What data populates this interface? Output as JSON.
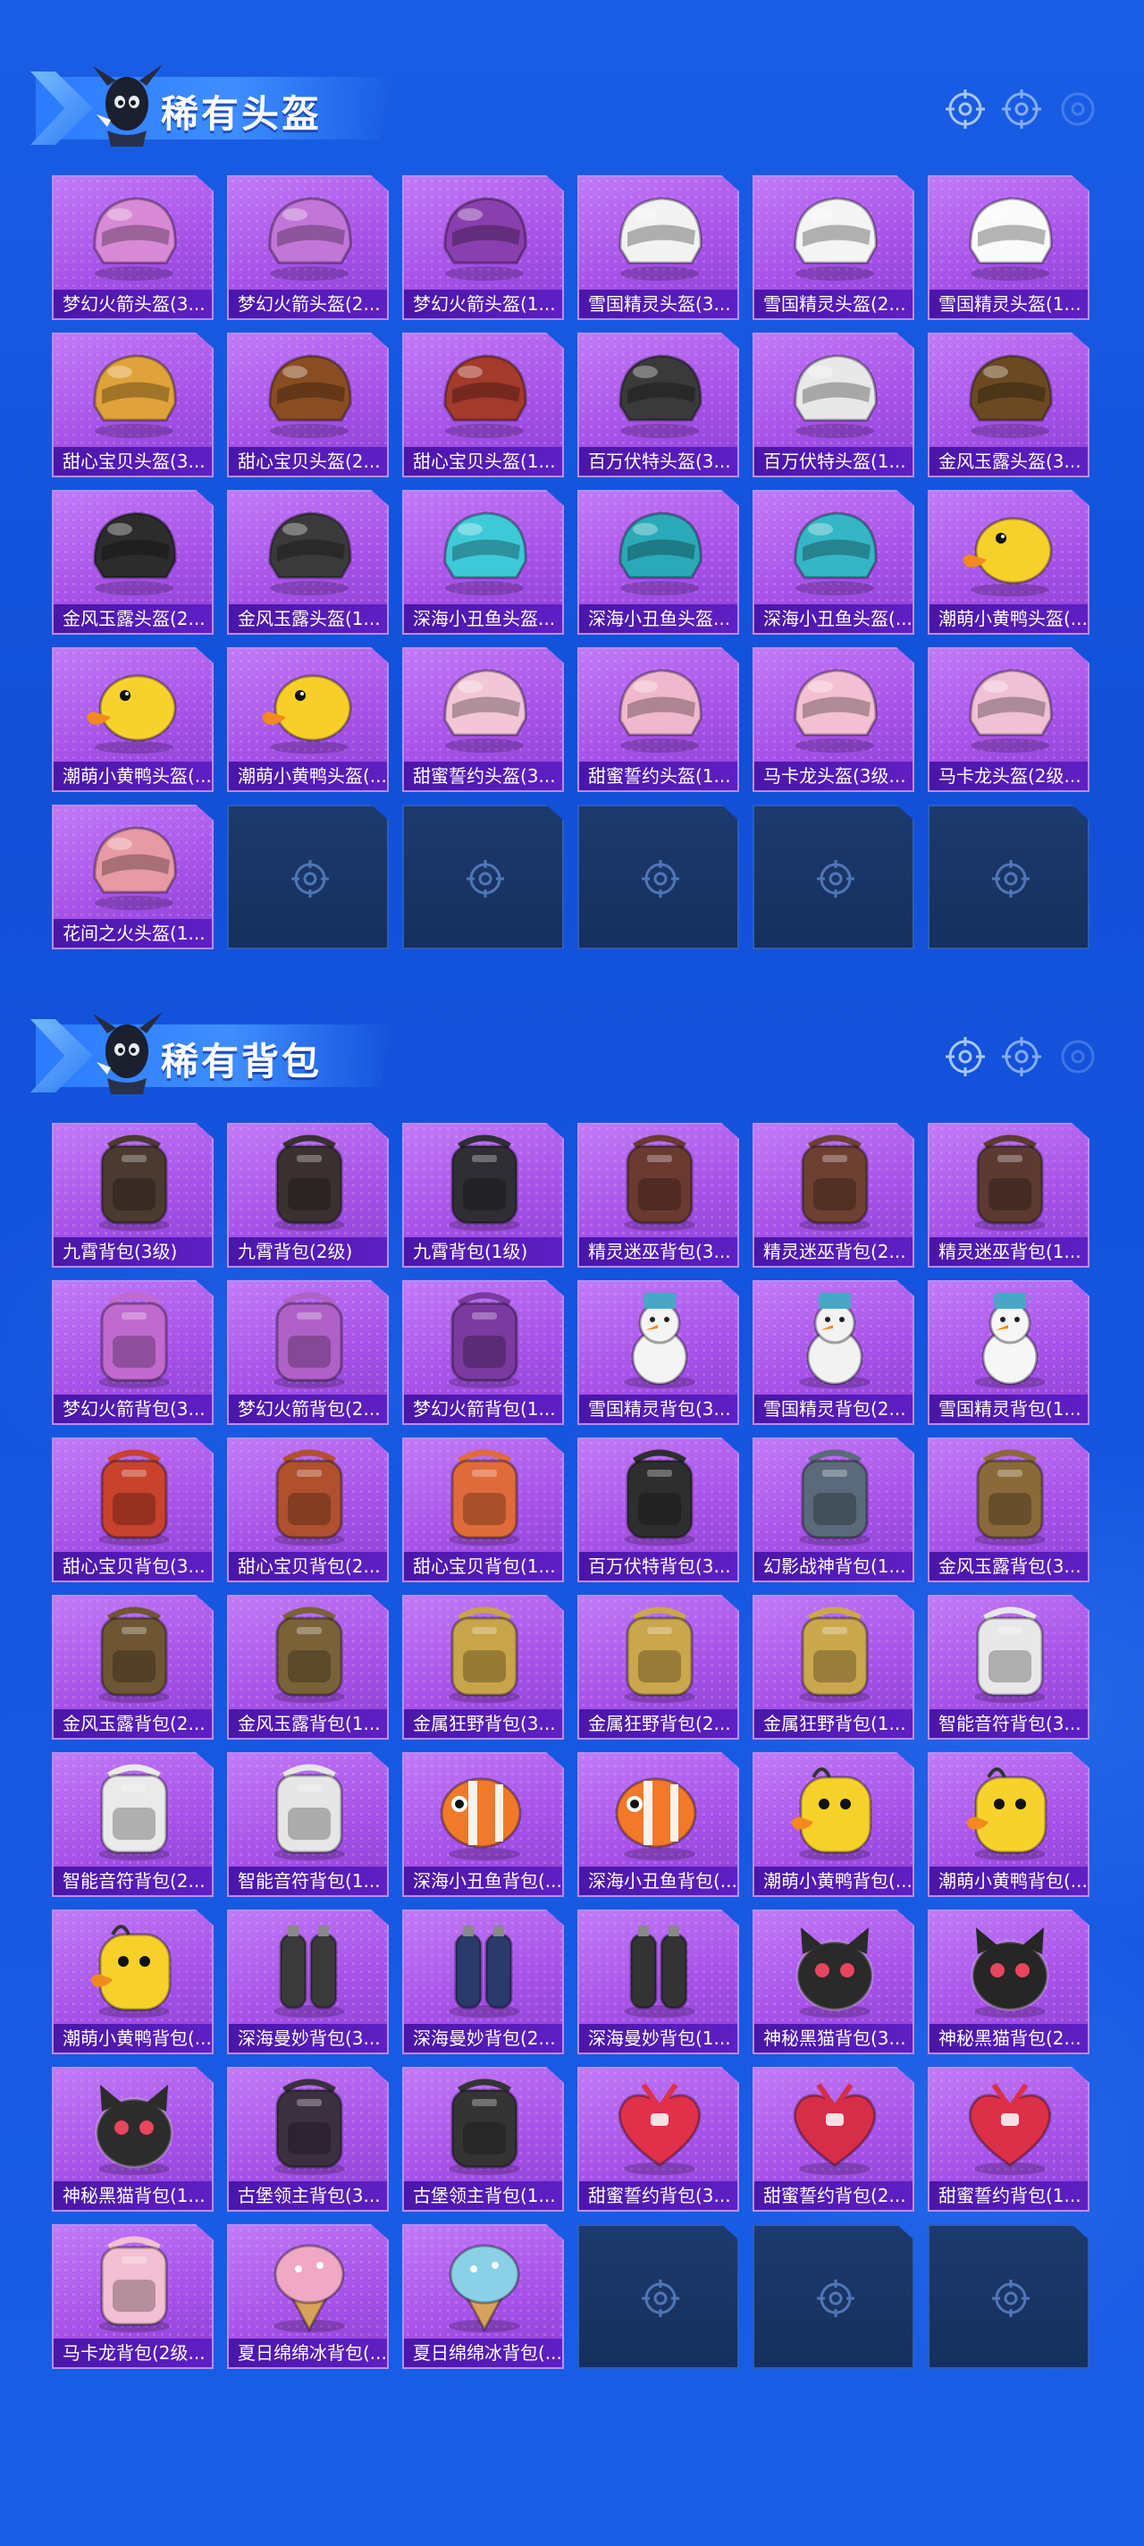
{
  "colors": {
    "background": "#1656e0",
    "card_purple": "#a752e8",
    "card_label": "#4a16a8",
    "empty_slot": "#1d3a6e"
  },
  "helmets": {
    "title": "稀有头盔",
    "items": [
      {
        "label": "梦幻火箭头盔(3...",
        "icon": "helmet-icon",
        "color": "#d88ad6"
      },
      {
        "label": "梦幻火箭头盔(2...",
        "icon": "helmet-icon",
        "color": "#c276d8"
      },
      {
        "label": "梦幻火箭头盔(1...",
        "icon": "helmet-icon",
        "color": "#8a3fae"
      },
      {
        "label": "雪国精灵头盔(3...",
        "icon": "helmet-icon",
        "color": "#f2f2f2"
      },
      {
        "label": "雪国精灵头盔(2...",
        "icon": "helmet-icon",
        "color": "#f4f4f4"
      },
      {
        "label": "雪国精灵头盔(1...",
        "icon": "helmet-icon",
        "color": "#fafafa"
      },
      {
        "label": "甜心宝贝头盔(3...",
        "icon": "helmet-icon",
        "color": "#e0a23a"
      },
      {
        "label": "甜心宝贝头盔(2...",
        "icon": "helmet-icon",
        "color": "#8a4d22"
      },
      {
        "label": "甜心宝贝头盔(1...",
        "icon": "helmet-icon",
        "color": "#a33a2a"
      },
      {
        "label": "百万伏特头盔(3...",
        "icon": "helmet-icon",
        "color": "#3a3a3a"
      },
      {
        "label": "百万伏特头盔(1...",
        "icon": "helmet-icon",
        "color": "#e8e8e8"
      },
      {
        "label": "金风玉露头盔(3...",
        "icon": "helmet-icon",
        "color": "#6b4a22"
      },
      {
        "label": "金风玉露头盔(2...",
        "icon": "helmet-icon",
        "color": "#2c2c2c"
      },
      {
        "label": "金风玉露头盔(1...",
        "icon": "helmet-icon",
        "color": "#3a3a3a"
      },
      {
        "label": "深海小丑鱼头盔...",
        "icon": "helmet-icon",
        "color": "#3ec9d8"
      },
      {
        "label": "深海小丑鱼头盔...",
        "icon": "helmet-icon",
        "color": "#2aa9b8"
      },
      {
        "label": "深海小丑鱼头盔(...",
        "icon": "helmet-icon",
        "color": "#35b6c6"
      },
      {
        "label": "潮萌小黄鸭头盔(...",
        "icon": "duck-helmet-icon",
        "color": "#f6d12a"
      },
      {
        "label": "潮萌小黄鸭头盔(...",
        "icon": "duck-helmet-icon",
        "color": "#f8d22c"
      },
      {
        "label": "潮萌小黄鸭头盔(...",
        "icon": "duck-helmet-icon",
        "color": "#f8cf28"
      },
      {
        "label": "甜蜜誓约头盔(3...",
        "icon": "helmet-icon",
        "color": "#f2c6d6"
      },
      {
        "label": "甜蜜誓约头盔(1...",
        "icon": "helmet-icon",
        "color": "#f0b8cc"
      },
      {
        "label": "马卡龙头盔(3级...",
        "icon": "helmet-icon",
        "color": "#f3bfd2"
      },
      {
        "label": "马卡龙头盔(2级...",
        "icon": "helmet-icon",
        "color": "#f0c0d4"
      },
      {
        "label": "花间之火头盔(1...",
        "icon": "helmet-icon",
        "color": "#e89aa4"
      }
    ],
    "empty_slots": 5
  },
  "backpacks": {
    "title": "稀有背包",
    "items": [
      {
        "label": "九霄背包(3级)",
        "icon": "backpack-icon",
        "color": "#4a3a30"
      },
      {
        "label": "九霄背包(2级)",
        "icon": "backpack-icon",
        "color": "#3a3030"
      },
      {
        "label": "九霄背包(1级)",
        "icon": "backpack-icon",
        "color": "#2e2e34"
      },
      {
        "label": "精灵迷巫背包(3...",
        "icon": "backpack-icon",
        "color": "#6a3a30"
      },
      {
        "label": "精灵迷巫背包(2...",
        "icon": "backpack-icon",
        "color": "#6e4032"
      },
      {
        "label": "精灵迷巫背包(1...",
        "icon": "backpack-icon",
        "color": "#5c3a32"
      },
      {
        "label": "梦幻火箭背包(3...",
        "icon": "backpack-icon",
        "color": "#c06ad0"
      },
      {
        "label": "梦幻火箭背包(2...",
        "icon": "backpack-icon",
        "color": "#b061c8"
      },
      {
        "label": "梦幻火箭背包(1...",
        "icon": "backpack-icon",
        "color": "#7a3aa0"
      },
      {
        "label": "雪国精灵背包(3...",
        "icon": "snowman-icon",
        "color": "#f4f4f4"
      },
      {
        "label": "雪国精灵背包(2...",
        "icon": "snowman-icon",
        "color": "#f2f2f2"
      },
      {
        "label": "雪国精灵背包(1...",
        "icon": "snowman-icon",
        "color": "#f6f6f6"
      },
      {
        "label": "甜心宝贝背包(3...",
        "icon": "backpack-icon",
        "color": "#c9422e"
      },
      {
        "label": "甜心宝贝背包(2...",
        "icon": "backpack-icon",
        "color": "#b0502e"
      },
      {
        "label": "甜心宝贝背包(1...",
        "icon": "backpack-icon",
        "color": "#e06b3a"
      },
      {
        "label": "百万伏特背包(3...",
        "icon": "backpack-icon",
        "color": "#2e2e2e"
      },
      {
        "label": "幻影战神背包(1...",
        "icon": "backpack-icon",
        "color": "#5a6a7a"
      },
      {
        "label": "金风玉露背包(3...",
        "icon": "backpack-icon",
        "color": "#8a6a3a"
      },
      {
        "label": "金风玉露背包(2...",
        "icon": "backpack-icon",
        "color": "#6e5634"
      },
      {
        "label": "金风玉露背包(1...",
        "icon": "backpack-icon",
        "color": "#7a6238"
      },
      {
        "label": "金属狂野背包(3...",
        "icon": "backpack-icon",
        "color": "#c8a44a"
      },
      {
        "label": "金属狂野背包(2...",
        "icon": "backpack-icon",
        "color": "#caa64c"
      },
      {
        "label": "金属狂野背包(1...",
        "icon": "backpack-icon",
        "color": "#cba84e"
      },
      {
        "label": "智能音符背包(3...",
        "icon": "backpack-icon",
        "color": "#e8e8e8"
      },
      {
        "label": "智能音符背包(2...",
        "icon": "backpack-icon",
        "color": "#eaeaea"
      },
      {
        "label": "智能音符背包(1...",
        "icon": "backpack-icon",
        "color": "#e6e6e6"
      },
      {
        "label": "深海小丑鱼背包(...",
        "icon": "fish-icon",
        "color": "#f07a2a"
      },
      {
        "label": "深海小丑鱼背包(...",
        "icon": "fish-icon",
        "color": "#f2782a"
      },
      {
        "label": "潮萌小黄鸭背包(...",
        "icon": "duck-icon",
        "color": "#f6d12a"
      },
      {
        "label": "潮萌小黄鸭背包(...",
        "icon": "duck-icon",
        "color": "#f8d22c"
      },
      {
        "label": "潮萌小黄鸭背包(...",
        "icon": "duck-icon",
        "color": "#f7d02a"
      },
      {
        "label": "深海曼妙背包(3...",
        "icon": "tank-icon",
        "color": "#3a3a3a"
      },
      {
        "label": "深海曼妙背包(2...",
        "icon": "tank-icon",
        "color": "#2a3a6a"
      },
      {
        "label": "深海曼妙背包(1...",
        "icon": "tank-icon",
        "color": "#333333"
      },
      {
        "label": "神秘黑猫背包(3...",
        "icon": "cat-icon",
        "color": "#2a2a2a"
      },
      {
        "label": "神秘黑猫背包(2...",
        "icon": "cat-icon",
        "color": "#262626"
      },
      {
        "label": "神秘黑猫背包(1...",
        "icon": "cat-icon",
        "color": "#2c2c2c"
      },
      {
        "label": "古堡领主背包(3...",
        "icon": "backpack-icon",
        "color": "#3a3040"
      },
      {
        "label": "古堡领主背包(1...",
        "icon": "backpack-icon",
        "color": "#343434"
      },
      {
        "label": "甜蜜誓约背包(3...",
        "icon": "heart-icon",
        "color": "#e0304a"
      },
      {
        "label": "甜蜜誓约背包(2...",
        "icon": "heart-icon",
        "color": "#d62e48"
      },
      {
        "label": "甜蜜誓约背包(1...",
        "icon": "heart-icon",
        "color": "#dc3048"
      },
      {
        "label": "马卡龙背包(2级...",
        "icon": "backpack-icon",
        "color": "#f3bfd2"
      },
      {
        "label": "夏日绵绵冰背包(...",
        "icon": "icecream-icon",
        "color": "#f0a8c4"
      },
      {
        "label": "夏日绵绵冰背包(...",
        "icon": "icecream-icon",
        "color": "#8ad0e6"
      }
    ],
    "empty_slots": 3
  }
}
